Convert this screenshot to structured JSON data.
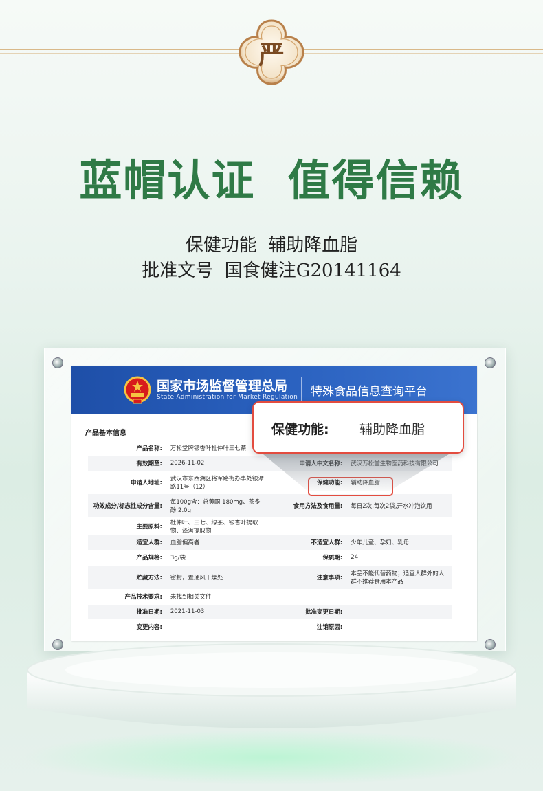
{
  "badge": {
    "char": "严",
    "icon": "quatrefoil-seal-icon"
  },
  "headline": "蓝帽认证  值得信赖",
  "subline_1": "保健功能  辅助降血脂",
  "subline_2": "批准文号  国食健注G20141164",
  "certificate": {
    "org_cn": "国家市场监督管理总局",
    "org_en": "State Administration  for  Market Regulation",
    "platform": "特殊食品信息查询平台",
    "emblem_icon": "national-emblem-icon",
    "section_title": "产品基本信息",
    "rows": [
      {
        "k1": "产品名称:",
        "v1": "万松堂牌银杏叶杜仲叶三七茶",
        "k2": "",
        "v2": ""
      },
      {
        "k1": "有效期至:",
        "v1": "2026-11-02",
        "k2": "申请人中文名称:",
        "v2": "武汉万松堂生物医药科技有限公司"
      },
      {
        "k1": "申请人地址:",
        "v1": "武汉市东西湖区将军路街办事处银潭路11号（12）",
        "k2": "保健功能:",
        "v2": "辅助降血脂"
      },
      {
        "k1": "功效成分/标志性成分含量:",
        "v1": "每100g含：总黄酮 180mg、茶多酚 2.0g",
        "k2": "食用方法及食用量:",
        "v2": "每日2次,每次2袋,开水冲泡饮用"
      },
      {
        "k1": "主要原料:",
        "v1": "杜仲叶、三七、绿茶、银杏叶提取物、泽泻提取物",
        "k2": "",
        "v2": ""
      },
      {
        "k1": "适宜人群:",
        "v1": "血脂偏高者",
        "k2": "不适宜人群:",
        "v2": "少年儿童、孕妇、乳母"
      },
      {
        "k1": "产品规格:",
        "v1": "3g/袋",
        "k2": "保质期:",
        "v2": "24"
      },
      {
        "k1": "贮藏方法:",
        "v1": "密封，置通风干燥处",
        "k2": "注意事项:",
        "v2": "本品不能代替药物；适宜人群外的人群不推荐食用本产品"
      },
      {
        "k1": "产品技术要求:",
        "v1": "未找到相关文件",
        "k2": "",
        "v2": ""
      },
      {
        "k1": "批准日期:",
        "v1": "2021-11-03",
        "k2": "批准变更日期:",
        "v2": ""
      },
      {
        "k1": "变更内容:",
        "v1": "",
        "k2": "注销原因:",
        "v2": ""
      }
    ]
  },
  "callout": {
    "label": "保健功能:",
    "value": "辅助降血脂"
  },
  "colors": {
    "headline": "#2f7a46",
    "banner": "#1e4fa8",
    "highlight": "#e34c3f",
    "gold": "#d9b98a"
  }
}
